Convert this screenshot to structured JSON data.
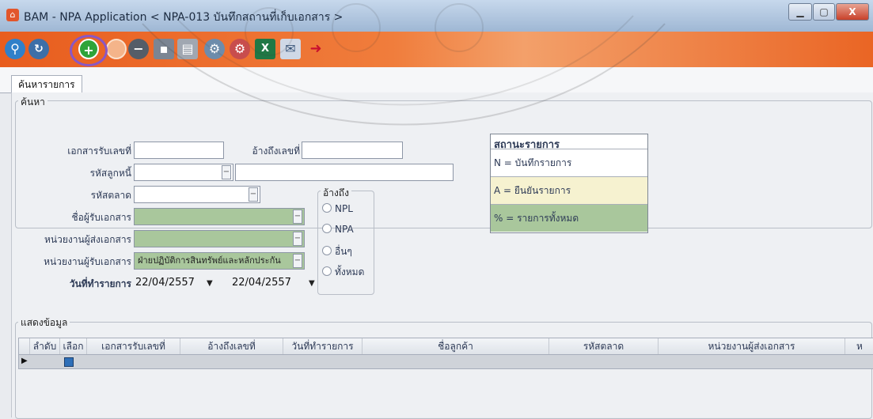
{
  "window": {
    "title": "BAM - NPA Application < NPA-013 บันทึกสถานที่เก็บเอกสาร >",
    "controls": {
      "minimize": "▁",
      "maximize": "▢",
      "close": "X"
    }
  },
  "toolbar": {
    "buttons": [
      "search-icon",
      "refresh-icon",
      "add-icon",
      "clear-icon",
      "delete-icon",
      "save-icon",
      "print-icon",
      "gear-icon",
      "gear-alert-icon",
      "excel-icon",
      "mail-icon",
      "exit-icon"
    ]
  },
  "tabs": [
    "ค้นหารายการ"
  ],
  "search": {
    "group_label": "ค้นหา",
    "doc_received_no_label": "เอกสารรับเลขที่",
    "doc_received_no_value": "",
    "ref_no_label": "อ้างถึงเลขที่",
    "ref_no_value": "",
    "debtor_code_label": "รหัสลูกหนี้",
    "debtor_code_value": "",
    "debtor_name_value": "",
    "market_code_label": "รหัสตลาด",
    "market_code_value": "",
    "recipient_label": "ชื่อผู้รับเอกสาร",
    "recipient_value": "",
    "sender_unit_label": "หน่วยงานผู้ส่งเอกสาร",
    "sender_unit_value": "",
    "receiver_unit_label": "หน่วยงานผู้รับเอกสาร",
    "receiver_unit_value": "ฝ่ายปฏิบัติการสินทรัพย์และหลักประกัน",
    "date_label": "วันที่ทำรายการ",
    "date_from": "22/04/2557",
    "date_to": "22/04/2557",
    "ref_group_label": "อ้างถึง",
    "ref_options": [
      "NPL",
      "NPA",
      "อื่นๆ",
      "ทั้งหมด"
    ]
  },
  "status": {
    "title": "สถานะรายการ",
    "items": [
      {
        "label": "N = บันทึกรายการ",
        "color": "#ffffff"
      },
      {
        "label": "A = ยืนยันรายการ",
        "color": "#f6f2d0"
      },
      {
        "label": "% = รายการทั้งหมด",
        "color": "#a9c79c"
      }
    ]
  },
  "grid": {
    "group_label": "แสดงข้อมูล",
    "columns": [
      "ลำดับ",
      "เลือก",
      "เอกสารรับเลขที่",
      "อ้างถึงเลขที่",
      "วันที่ทำรายการ",
      "ชื่อลูกค้า",
      "รหัสตลาด",
      "หน่วยงานผู้ส่งเอกสาร",
      "ห"
    ]
  },
  "colors": {
    "toolbar_accent": "#e85d1e",
    "highlight_ring": "#8a57c4",
    "green_field": "#a9c79c"
  }
}
